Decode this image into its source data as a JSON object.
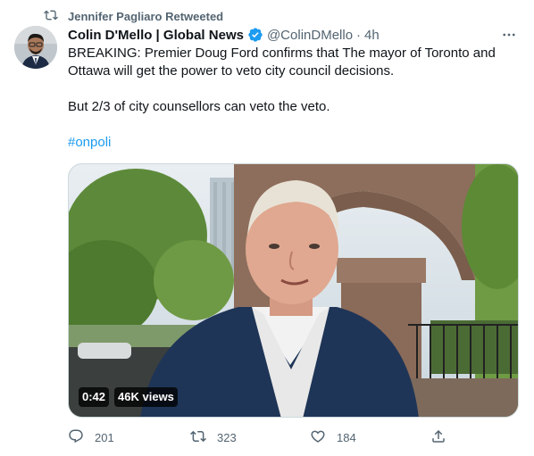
{
  "retweet": {
    "icon": "retweet-icon",
    "text": "Jennifer Pagliaro Retweeted"
  },
  "author": {
    "name": "Colin D'Mello | Global News",
    "verified_icon": "verified-badge-icon",
    "handle": "@ColinDMello",
    "separator": "·",
    "time": "4h"
  },
  "tweet": {
    "line1": "BREAKING: Premier Doug Ford confirms that The mayor of Toronto and Ottawa will get the power to veto city council decisions.",
    "line2": "But 2/3 of city counsellors can veto the veto.",
    "hashtag": "#onpoli"
  },
  "video": {
    "duration": "0:42",
    "views": "46K views"
  },
  "actions": {
    "reply_count": "201",
    "retweet_count": "323",
    "like_count": "184"
  },
  "colors": {
    "accent": "#1d9bf0",
    "secondary_text": "#536471",
    "primary_text": "#0f1419"
  }
}
